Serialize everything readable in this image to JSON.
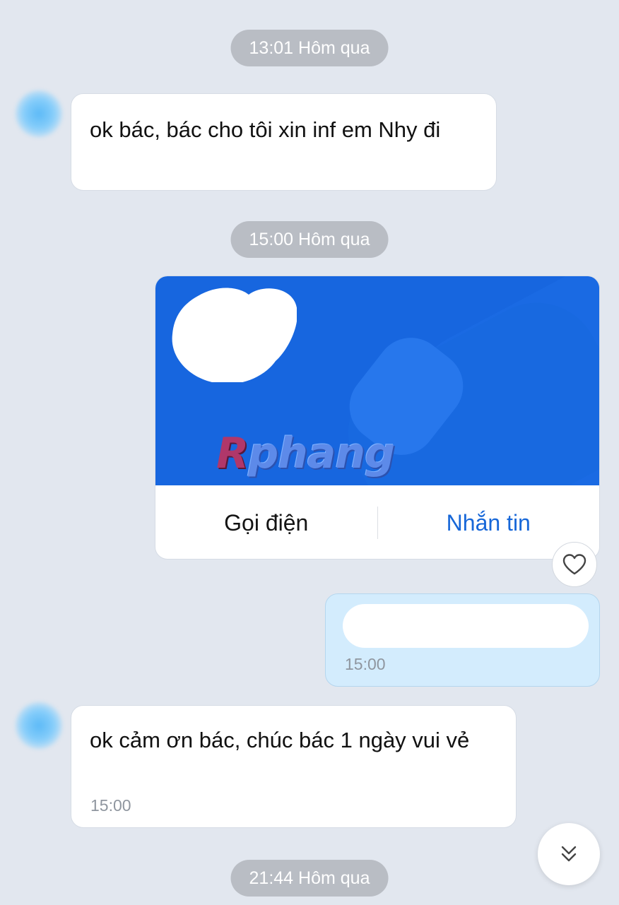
{
  "timestamps": {
    "first": "13:01 Hôm qua",
    "second": "15:00 Hôm qua",
    "third": "21:44 Hôm qua"
  },
  "messages": {
    "received_1": {
      "text": "ok bác, bác cho tôi xin inf em Nhy đi"
    },
    "sent_card": {
      "watermark": "Rphang",
      "call_label": "Gọi điện",
      "message_label": "Nhắn tin",
      "banner_color": "#1766df"
    },
    "sent_text": {
      "time": "15:00"
    },
    "received_2": {
      "text": "ok cảm ơn bác, chúc bác 1 ngày vui vẻ",
      "time": "15:00"
    }
  },
  "icons": {
    "reaction": "heart-icon",
    "scroll": "double-chevron-down-icon"
  },
  "colors": {
    "background": "#e2e7ef",
    "sent_bubble": "#d3ecfd",
    "accent": "#1767d8"
  }
}
